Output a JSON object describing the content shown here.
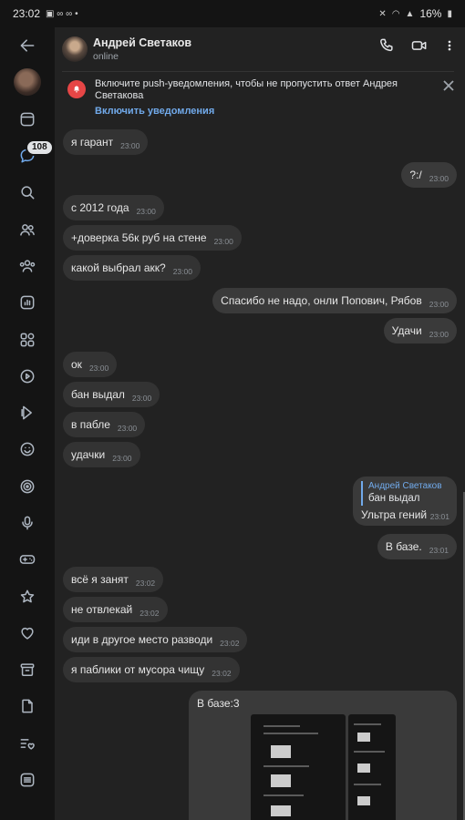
{
  "status_bar": {
    "time": "23:02",
    "battery": "16%"
  },
  "rail": {
    "unread_badge": "108"
  },
  "chat": {
    "contact_name": "Андрей Светаков",
    "contact_status": "online"
  },
  "push_banner": {
    "text": "Включите push-уведомления, чтобы не пропустить ответ Андрея Светакова",
    "action": "Включить уведомления"
  },
  "messages": [
    {
      "text": "я гарант",
      "time": "23:00",
      "dir": "in"
    },
    {
      "text": "?:/",
      "time": "23:00",
      "dir": "out"
    },
    {
      "text": "с 2012 года",
      "time": "23:00",
      "dir": "in"
    },
    {
      "text": "+доверка 56к руб на стене",
      "time": "23:00",
      "dir": "in"
    },
    {
      "text": "какой выбрал акк?",
      "time": "23:00",
      "dir": "in"
    },
    {
      "text": "Спасибо не надо, онли Попович, Рябов",
      "time": "23:00",
      "dir": "out"
    },
    {
      "text": "Удачи",
      "time": "23:00",
      "dir": "out"
    },
    {
      "text": "ок",
      "time": "23:00",
      "dir": "in"
    },
    {
      "text": "бан выдал",
      "time": "23:00",
      "dir": "in"
    },
    {
      "text": "в пабле",
      "time": "23:00",
      "dir": "in"
    },
    {
      "text": "удачки",
      "time": "23:00",
      "dir": "in"
    },
    {
      "text": "В базе.",
      "time": "23:01",
      "dir": "out"
    },
    {
      "text": "всё я занят",
      "time": "23:02",
      "dir": "in"
    },
    {
      "text": "не отвлекай",
      "time": "23:02",
      "dir": "in"
    },
    {
      "text": "иди в другое место разводи",
      "time": "23:02",
      "dir": "in"
    },
    {
      "text": "я паблики от мусора чищу",
      "time": "23:02",
      "dir": "in"
    }
  ],
  "reply_message": {
    "quoted_author": "Андрей Светаков",
    "quoted_text": "бан выдал",
    "text": "Ультра гений",
    "time": "23:01"
  },
  "photo_message": {
    "caption": "В базе:3"
  },
  "colors": {
    "accent": "#71aaeb",
    "bubble": "#333333",
    "background": "#222222",
    "push_icon": "#e64646"
  }
}
